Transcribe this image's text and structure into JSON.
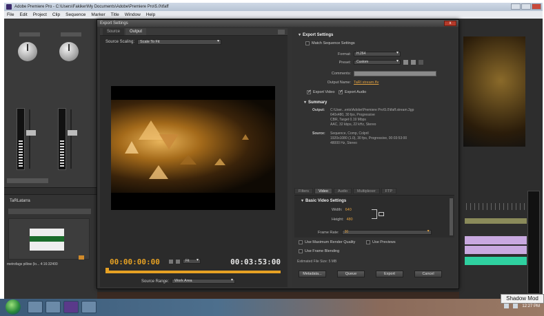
{
  "app": {
    "title": "Adobe Premiere Pro - C:\\Users\\Fakiker\\My Documents\\Adobe\\Premiere Pro\\5.0\\tfaff",
    "menu": [
      "File",
      "Edit",
      "Project",
      "Clip",
      "Sequence",
      "Marker",
      "Title",
      "Window",
      "Help"
    ]
  },
  "project": {
    "tab_label": "TaRLatarra",
    "item_name": "metrofags pillow (lo... 4:16:32400"
  },
  "dialog": {
    "title": "Export Settings",
    "close_label": "x",
    "tabs": [
      "Source",
      "Output"
    ],
    "source_scaling_label": "Source Scaling:",
    "source_scaling_value": "Scale To Fit",
    "timecode_start": "00:00:00:00",
    "timecode_end": "00:03:53:00",
    "zoom_value": "Fit",
    "source_range_label": "Source Range:",
    "source_range_value": "Work Area"
  },
  "export": {
    "section": "Export Settings",
    "match_sequence": "Match Sequence Settings",
    "format_label": "Format:",
    "format_value": "H.264",
    "preset_label": "Preset:",
    "preset_value": "Custom",
    "comments_label": "Comments:",
    "output_name_label": "Output Name:",
    "output_name_value": "TaRl stream.flv",
    "export_video": "Export Video",
    "export_audio": "Export Audio",
    "summary_label": "Summary",
    "output_label": "Output:",
    "output_lines": [
      "C:\\User...ents\\Adobe\\Premiere Pro\\5.0\\tfaff.stream.3gp",
      "640x480, 30 fps, Progressive",
      "CBR, Target 0.19 Mbps",
      "AAC, 32 kbps, 22 kHz, Stereo"
    ],
    "source_label": "Source:",
    "source_lines": [
      "Sequence, Comp, Colpril",
      "1920x1080 (1.0), 30 fps, Progressive, 00:03:53:00",
      "48000 Hz, Stereo"
    ],
    "settings_tabs": [
      "Filters",
      "Video",
      "Audio",
      "Multiplexer",
      "FTP"
    ],
    "basic_video": "Basic Video Settings",
    "width_label": "Width:",
    "width_value": "640",
    "height_label": "Height:",
    "height_value": "480",
    "frame_rate_label": "Frame Rate:",
    "frame_rate_value": "30",
    "use_max_quality": "Use Maximum Render Quality",
    "use_previews": "Use Previews",
    "use_frame_blending": "Use Frame Blending",
    "file_size": "Estimated File Size: 5 MB"
  },
  "buttons": [
    "Metadata...",
    "Queue",
    "Export",
    "Cancel"
  ],
  "taskbar": {
    "clock": "12:27 PM",
    "tooltip": "Shadow Mod"
  },
  "colors": {
    "accent": "#e6a123",
    "dialog_bg": "#333333",
    "title_close": "#b33a2a"
  }
}
